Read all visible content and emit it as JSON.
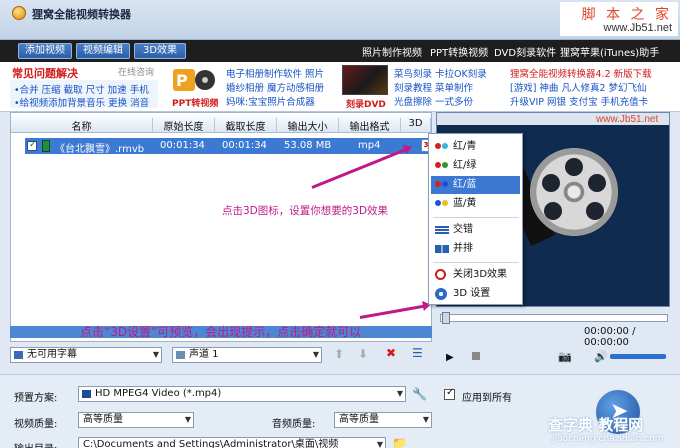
{
  "window": {
    "title": "狸窝全能视频转换器"
  },
  "watermark": {
    "line1": "脚 本 之 家",
    "line2": "www.Jb51.net",
    "site": "www.Jb51.net",
    "bottom1": "查字典 教程网",
    "bottom2": "jiaocheng.chazidian.com"
  },
  "menubar": {
    "tabs": [
      "添加视频",
      "视频编辑",
      "3D效果"
    ],
    "links": [
      "照片制作视频",
      "PPT转换视频",
      "DVD刻录软件",
      "狸窝苹果(iTunes)助手"
    ]
  },
  "banner": {
    "faq_title": "常见问题解决",
    "faq_online": "在线咨询",
    "faq_lines": [
      "•合并 压缩 截取 尺寸 加速 手机",
      "•给视频添加背景音乐 更换 消音"
    ],
    "ppt_label": "PPT转视频",
    "links_col1": [
      "电子相册制作软件 照片",
      "婚纱相册 魔方动感相册",
      "妈咪:宝宝照片合成器"
    ],
    "dvd_label": "刻录DVD",
    "links_col2": [
      "菜鸟刻录 卡拉OK刻录",
      "刻录教程 菜单制作",
      "光盘擦除 一式多份"
    ],
    "links_col3": [
      "狸窝全能视频转换器4.2 新版下载",
      "[游戏] 神曲 凡人修真2 梦幻飞仙",
      "升级VIP 网银 支付宝 手机充值卡"
    ]
  },
  "list": {
    "headers": [
      "名称",
      "原始长度",
      "截取长度",
      "输出大小",
      "输出格式",
      "3D"
    ],
    "rows": [
      {
        "name": "《台北飘雪》.rmvb",
        "orig_len": "00:01:34",
        "cut_len": "00:01:34",
        "size": "53.08 MB",
        "format": "mp4"
      }
    ]
  },
  "context_menu": {
    "items": [
      {
        "label": "红/青",
        "icon": "red-cyan-glasses-icon",
        "selected": false
      },
      {
        "label": "红/绿",
        "icon": "red-green-glasses-icon",
        "selected": false
      },
      {
        "label": "红/蓝",
        "icon": "red-blue-glasses-icon",
        "selected": true
      },
      {
        "label": "蓝/黄",
        "icon": "blue-yellow-glasses-icon",
        "selected": false
      },
      {
        "label": "交错",
        "icon": "interlace-icon",
        "selected": false
      },
      {
        "label": "并排",
        "icon": "side-by-side-icon",
        "selected": false
      },
      {
        "label": "关闭3D效果",
        "icon": "disable-icon",
        "selected": false
      },
      {
        "label": "3D 设置",
        "icon": "gear-icon",
        "selected": false
      }
    ]
  },
  "annotations": {
    "tip1": "点击3D图标，设置你想要的3D效果",
    "tip2": "点击“3D设置”可预览，会出现提示，点击确定就可以"
  },
  "player": {
    "time": "00:00:00 / 00:00:00"
  },
  "controls": {
    "subtitle": "无可用字幕",
    "audio": "声道 1"
  },
  "settings": {
    "preset_label": "预置方案:",
    "preset_value": "HD MPEG4 Video (*.mp4)",
    "apply_all": "应用到所有",
    "video_quality_label": "视频质量:",
    "video_quality": "高等质量",
    "audio_quality_label": "音频质量:",
    "audio_quality": "高等质量",
    "output_label": "输出目录:",
    "output_path": "C:\\Documents and Settings\\Administrator\\桌面\\视频"
  },
  "colors": {
    "accent": "#3b79d3",
    "annotation": "#c0198a",
    "brand_red": "#d21b1b"
  }
}
